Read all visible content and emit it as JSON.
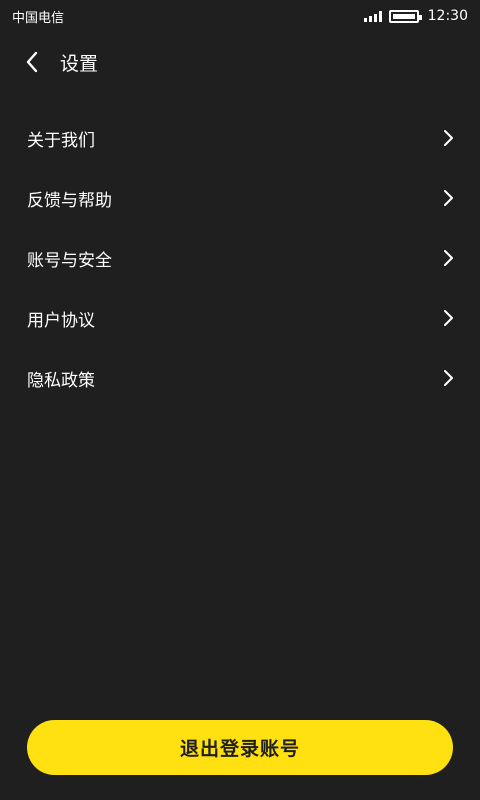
{
  "status_bar": {
    "carrier": "中国电信",
    "time": "12:30",
    "icons": [
      "signal-icon",
      "battery-icon"
    ]
  },
  "header": {
    "back_icon": "chevron-left-icon",
    "title": "设置"
  },
  "menu": {
    "items": [
      {
        "label": "关于我们",
        "icon": "chevron-right-icon"
      },
      {
        "label": "反馈与帮助",
        "icon": "chevron-right-icon"
      },
      {
        "label": "账号与安全",
        "icon": "chevron-right-icon"
      },
      {
        "label": "用户协议",
        "icon": "chevron-right-icon"
      },
      {
        "label": "隐私政策",
        "icon": "chevron-right-icon"
      }
    ]
  },
  "logout": {
    "label": "退出登录账号"
  },
  "colors": {
    "background": "#1f1f1f",
    "text": "#ffffff",
    "accent": "#ffe010"
  }
}
